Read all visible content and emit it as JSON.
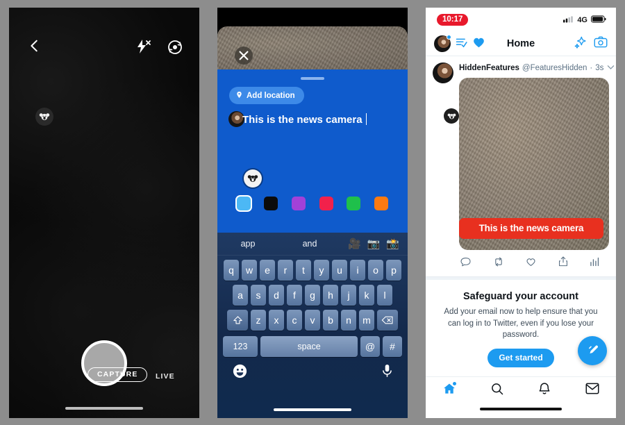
{
  "meta": {
    "background_color": "#8d8d8d",
    "panels": [
      "camera-screen",
      "compose-screen",
      "twitter-home-screen"
    ]
  },
  "panel1": {
    "name": "camera-capture-screen",
    "icons": {
      "back": "chevron-left-icon",
      "flash": "flash-off-icon",
      "flip": "camera-flip-icon",
      "watermark": "koala-watermark-icon"
    },
    "shutter_label": "shutter-button",
    "modes": [
      {
        "label": "CAPTURE",
        "selected": true
      },
      {
        "label": "LIVE",
        "selected": false
      }
    ]
  },
  "panel2": {
    "name": "tweet-compose-screen",
    "close_icon": "close-icon",
    "drag_handle": "drag-handle",
    "location_button": {
      "label": "Add location",
      "icon": "location-pin-icon"
    },
    "compose": {
      "text": "This is the news camera",
      "avatar": "user-avatar",
      "watermark": "koala-watermark-icon"
    },
    "background_color": "#0f5bcc",
    "swatches": [
      {
        "name": "light-blue",
        "color": "#4cb8f5",
        "selected": true
      },
      {
        "name": "black",
        "color": "#0b0b0b",
        "selected": false
      },
      {
        "name": "purple",
        "color": "#a241d8",
        "selected": false
      },
      {
        "name": "pink",
        "color": "#f2214b",
        "selected": false
      },
      {
        "name": "green",
        "color": "#1fc04b",
        "selected": false
      },
      {
        "name": "orange",
        "color": "#fb7a11",
        "selected": false
      }
    ],
    "keyboard": {
      "suggestions": [
        "app",
        "and"
      ],
      "suggestion_emoji": [
        "🎥",
        "📷",
        "📸"
      ],
      "row1": [
        "q",
        "w",
        "e",
        "r",
        "t",
        "y",
        "u",
        "i",
        "o",
        "p"
      ],
      "row2": [
        "a",
        "s",
        "d",
        "f",
        "g",
        "h",
        "j",
        "k",
        "l"
      ],
      "row3_shift": "shift-key",
      "row3": [
        "z",
        "x",
        "c",
        "v",
        "b",
        "n",
        "m"
      ],
      "row3_backspace": "backspace-key",
      "numeric_key": "123",
      "space_key": "space",
      "at_key": "@",
      "hash_key": "#",
      "emoji_key": "emoji-icon",
      "mic_key": "microphone-icon"
    }
  },
  "panel3": {
    "name": "twitter-home-screen",
    "status_bar": {
      "time": "10:17",
      "network": "4G",
      "signal": "signal-bars-icon",
      "battery": "battery-icon"
    },
    "header": {
      "title": "Home",
      "avatar": "user-avatar",
      "list_icon": "checklist-icon",
      "heart_icon": "heart-icon",
      "sparkle_icon": "sparkle-icon",
      "camera_icon": "camera-icon",
      "accent_color": "#1d9bf0"
    },
    "tweet": {
      "display_name": "HiddenFeatures",
      "handle": "@FeaturesHidden",
      "separator": "·",
      "timestamp": "3s",
      "chevron": "chevron-down-icon",
      "caption": "This is the news camera",
      "caption_bg": "#e8301f",
      "watermark": "koala-watermark-icon",
      "actions": [
        "reply-icon",
        "retweet-icon",
        "like-icon",
        "share-icon",
        "analytics-icon"
      ]
    },
    "promo": {
      "title": "Safeguard your account",
      "body": "Add your email now to help ensure that you can log in to Twitter, even if you lose your password.",
      "button": "Get started"
    },
    "compose_fab": "compose-tweet-icon",
    "tabbar": [
      {
        "name": "home-tab",
        "icon": "home-icon",
        "active": true,
        "badge": true
      },
      {
        "name": "search-tab",
        "icon": "search-icon",
        "active": false
      },
      {
        "name": "notifications-tab",
        "icon": "bell-icon",
        "active": false
      },
      {
        "name": "messages-tab",
        "icon": "envelope-icon",
        "active": false
      }
    ]
  }
}
